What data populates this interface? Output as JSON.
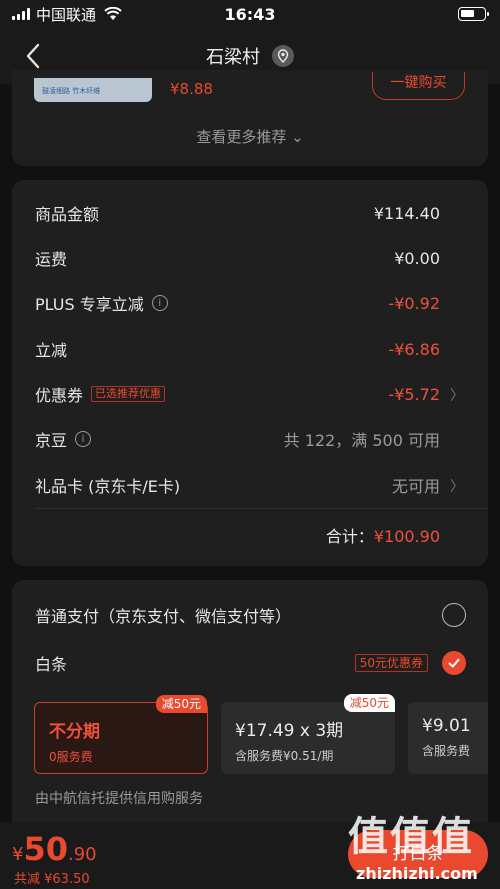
{
  "status_bar": {
    "carrier": "中国联通",
    "time": "16:43",
    "battery_level": 0.6
  },
  "nav": {
    "title": "石梁村"
  },
  "recommend": {
    "product_price_partial": "¥8.88",
    "product_thumb_text": "鼓凌细路  竹木纤维",
    "buy_button": "一键购买",
    "more_link": "查看更多推荐 ⌄"
  },
  "summary": {
    "rows": [
      {
        "label": "商品金额",
        "value": "¥114.40"
      },
      {
        "label": "运费",
        "value": "¥0.00"
      },
      {
        "label": "PLUS 专享立减",
        "value": "-¥0.92"
      },
      {
        "label": "立减",
        "value": "-¥6.86"
      },
      {
        "label": "优惠券",
        "tag": "已选推荐优惠",
        "value": "-¥5.72"
      },
      {
        "label": "京豆",
        "value": "共 122，满 500 可用"
      },
      {
        "label": "礼品卡 (京东卡/E卡)",
        "value": "无可用"
      }
    ],
    "total_label": "合计：",
    "total_value": "¥100.90"
  },
  "payment": {
    "normal_label": "普通支付（京东支付、微信支付等）",
    "baitiao_label": "白条",
    "baitiao_coupon": "50元优惠券",
    "plans": [
      {
        "title": "不分期",
        "sub": "0服务费",
        "badge": "减50元"
      },
      {
        "title": "¥17.49 x 3期",
        "sub": "含服务费¥0.51/期",
        "badge": "减50元"
      },
      {
        "title": "¥9.01",
        "sub": "含服务费",
        "badge": ""
      }
    ],
    "provider": "由中航信托提供信用购服务"
  },
  "bottom": {
    "yen": "¥",
    "price_int": "50",
    "price_dec": ".90",
    "saved": "共减 ¥63.50",
    "submit": "打白条"
  },
  "watermark": {
    "logo": "值值值",
    "text": "zhizhizhi.com"
  },
  "colors": {
    "accent": "#e8492f",
    "background": "#111111",
    "card": "#1f1f1f"
  }
}
